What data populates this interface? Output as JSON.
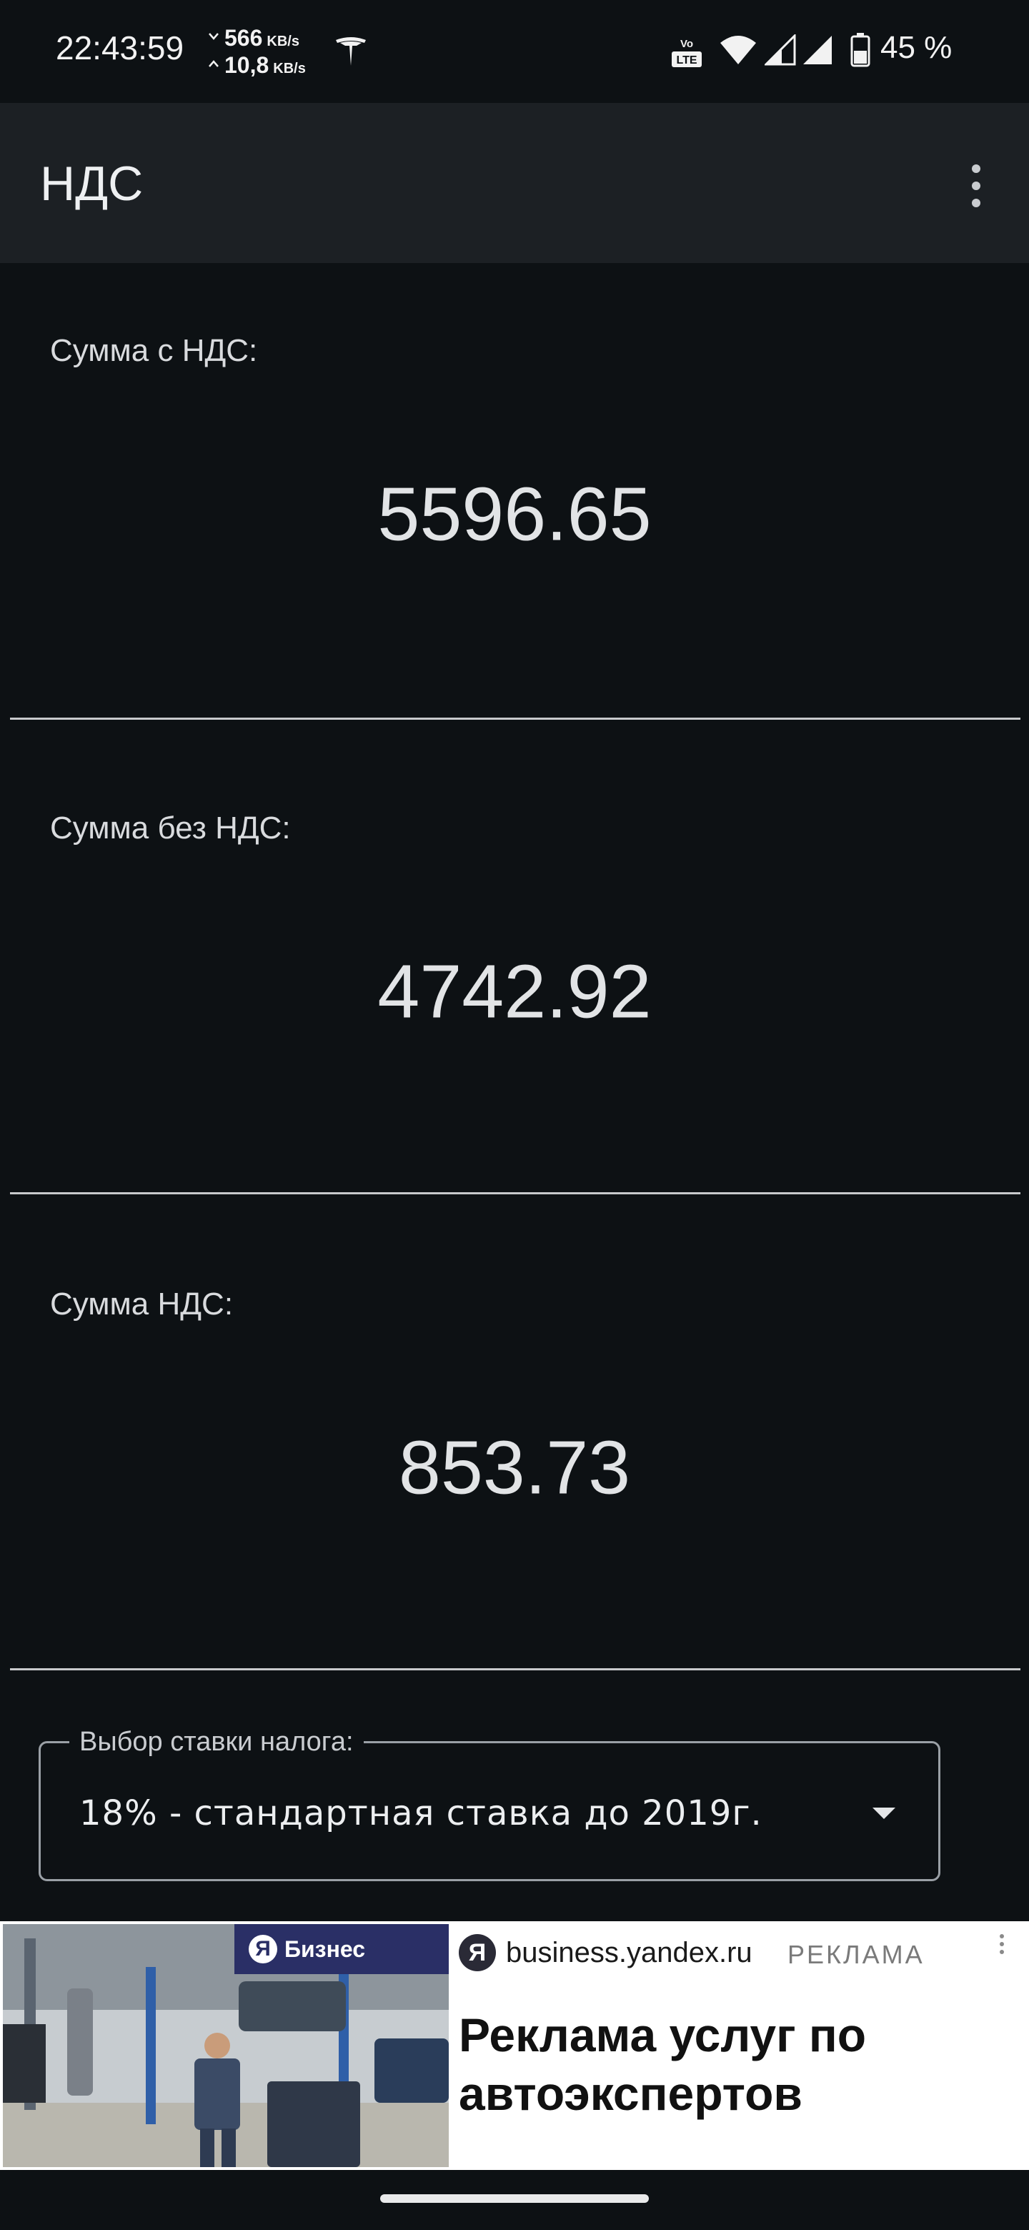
{
  "status_bar": {
    "time": "22:43:59",
    "speed_down": "566",
    "speed_down_unit": "KB/s",
    "speed_up": "10,8",
    "speed_up_unit": "KB/s",
    "battery_percent": "45 %",
    "volte_label": "LTE",
    "icons": [
      "tesla-icon",
      "volte-icon",
      "wifi-icon",
      "signal-icon",
      "signal-icon",
      "battery-icon"
    ]
  },
  "app_bar": {
    "title": "НДС",
    "overflow_icon": "more-vertical-icon"
  },
  "results": [
    {
      "label": "Сумма с НДС:",
      "value": "5596.65"
    },
    {
      "label": "Сумма без НДС:",
      "value": "4742.92"
    },
    {
      "label": "Сумма НДС:",
      "value": "853.73"
    }
  ],
  "tax_rate": {
    "legend": "Выбор ставки налога:",
    "selected": "18% - стандартная ставка до 2019г."
  },
  "ad": {
    "badge": "Бизнес",
    "badge_logo": "Я",
    "logo_letter": "Я",
    "domain": "business.yandex.ru",
    "tag": "РЕКЛАМА",
    "headline": "Реклама услуг по автоэкспертов"
  },
  "colors": {
    "background": "#0d1114",
    "app_bar": "#1c2024",
    "text": "#e4e6e8",
    "ad_badge": "#2a2f66"
  }
}
